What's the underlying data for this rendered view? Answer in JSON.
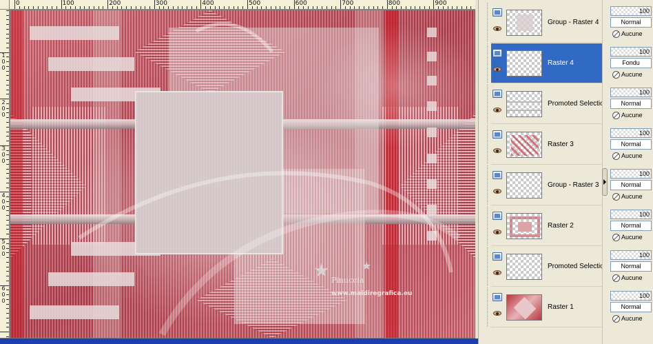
{
  "ruler": {
    "top_labels": [
      "0",
      "100",
      "200",
      "300",
      "400",
      "500",
      "600",
      "700",
      "800",
      "900"
    ],
    "left_labels": [
      "100",
      "200",
      "300",
      "400",
      "500",
      "600"
    ]
  },
  "watermark": {
    "name": "Pinuccia",
    "url": "www.maidiregrafica.eu"
  },
  "layers": [
    {
      "name": "Group - Raster 4",
      "opacity": "100",
      "blend": "Normal",
      "group": "Aucune",
      "selected": false
    },
    {
      "name": "Raster 4",
      "opacity": "100",
      "blend": "Fondu",
      "group": "Aucune",
      "selected": true
    },
    {
      "name": "Promoted Selection",
      "opacity": "100",
      "blend": "Normal",
      "group": "Aucune",
      "selected": false
    },
    {
      "name": "Raster 3",
      "opacity": "100",
      "blend": "Normal",
      "group": "Aucune",
      "selected": false
    },
    {
      "name": "Group - Raster 3",
      "opacity": "100",
      "blend": "Normal",
      "group": "Aucune",
      "selected": false
    },
    {
      "name": "Raster 2",
      "opacity": "100",
      "blend": "Normal",
      "group": "Aucune",
      "selected": false
    },
    {
      "name": "Promoted Selection",
      "opacity": "100",
      "blend": "Normal",
      "group": "Aucune",
      "selected": false
    },
    {
      "name": "Raster 1",
      "opacity": "100",
      "blend": "Normal",
      "group": "Aucune",
      "selected": false
    }
  ],
  "colors": {
    "canvas_base": "#b44650",
    "selection": "#316ac5",
    "scrollbar": "#1b3fb0"
  },
  "icons": {
    "layer_visibility": "eye-icon",
    "layer_type": "raster-layer-icon",
    "group_link": "link-icon",
    "collapse": "chevron-right-icon"
  }
}
